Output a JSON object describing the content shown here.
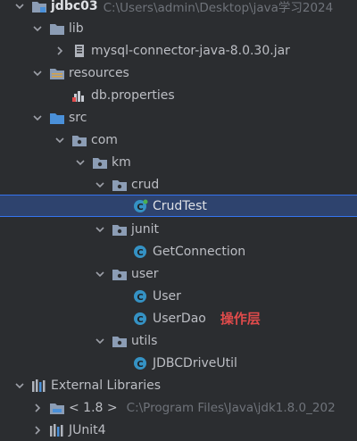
{
  "project": {
    "name": "jdbc03",
    "path": "C:\\Users\\admin\\Desktop\\java学习2024"
  },
  "tree": {
    "lib": "lib",
    "jar": "mysql-connector-java-8.0.30.jar",
    "resources": "resources",
    "db_properties": "db.properties",
    "src": "src",
    "com": "com",
    "km": "km",
    "crud": "crud",
    "crud_test": "CrudTest",
    "junit": "junit",
    "get_connection": "GetConnection",
    "user_pkg": "user",
    "user_class": "User",
    "user_dao": "UserDao",
    "user_dao_note": "操作层",
    "utils": "utils",
    "jdbc_util": "JDBCDriveUtil",
    "external_libraries": "External Libraries",
    "jdk_label": "< 1.8 >",
    "jdk_path": "C:\\Program Files\\Java\\jdk1.8.0_202",
    "junit4": "JUnit4"
  },
  "colors": {
    "background": "#2b2d30",
    "selected_row": "#2e436e",
    "folder": "#8c9db5",
    "source_folder": "#4a90d9",
    "class_icon": "#3592c4",
    "annotation": "#e04b4b"
  }
}
